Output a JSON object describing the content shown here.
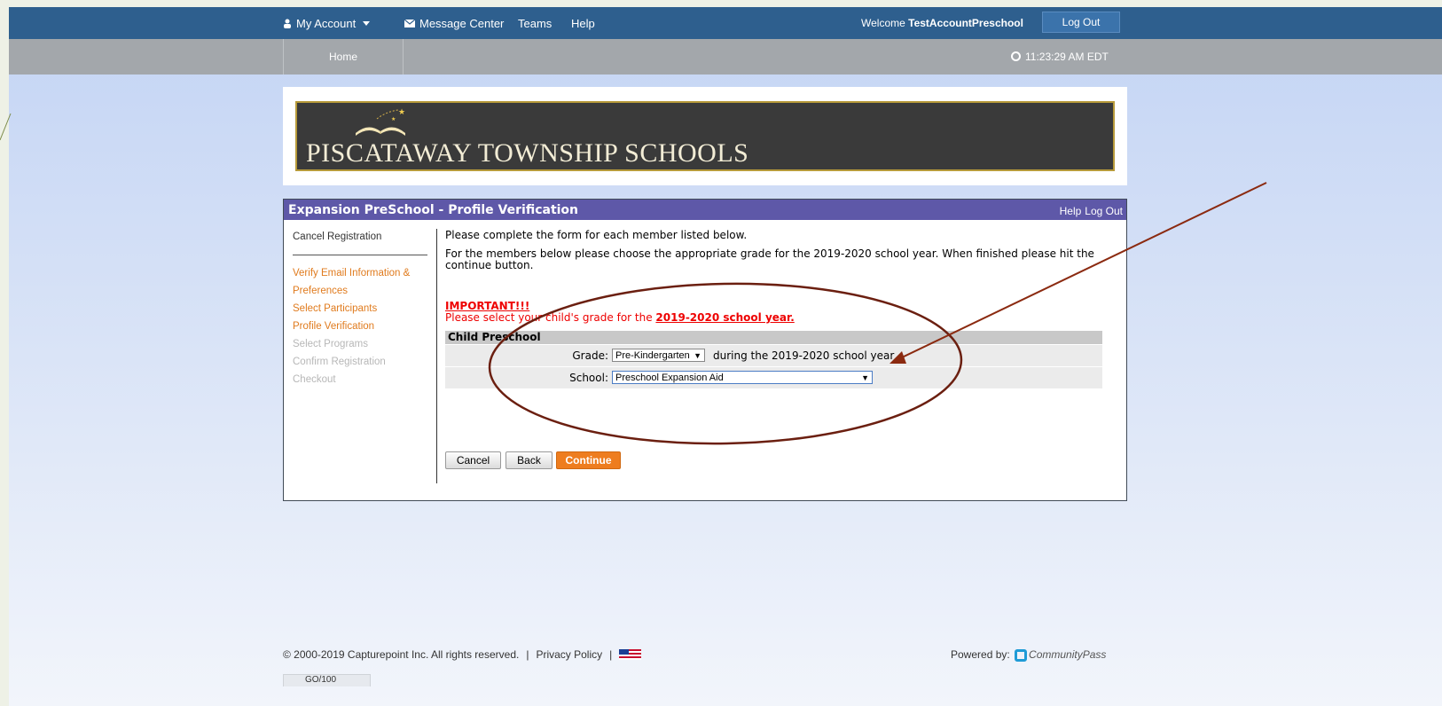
{
  "topbar": {
    "my_account": "My Account",
    "message_center": "Message Center",
    "teams": "Teams",
    "help": "Help",
    "welcome_prefix": "Welcome ",
    "username": "TestAccountPreschool",
    "logout": "Log Out"
  },
  "subbar": {
    "home": "Home",
    "time": "11:23:29 AM EDT"
  },
  "banner": {
    "title": "PISCATAWAY TOWNSHIP SCHOOLS"
  },
  "panel": {
    "title": "Expansion PreSchool - Profile Verification",
    "help": "Help",
    "logout": "Log Out"
  },
  "sidenav": {
    "cancel": "Cancel Registration",
    "steps": [
      {
        "label": "Verify Email Information & Preferences",
        "state": "done"
      },
      {
        "label": "Select Participants",
        "state": "done"
      },
      {
        "label": "Profile Verification",
        "state": "current"
      },
      {
        "label": "Select Programs",
        "state": "todo"
      },
      {
        "label": "Confirm Registration",
        "state": "todo"
      },
      {
        "label": "Checkout",
        "state": "todo"
      }
    ]
  },
  "content": {
    "intro": "Please complete the form for each member listed below.",
    "instructions": "For the members below please choose the appropriate grade for the 2019-2020 school year. When finished please hit the continue button.",
    "important": "IMPORTANT!!!",
    "select_prefix": "Please select your child's grade for the ",
    "select_year": "2019-2020 school year.",
    "member_name": "Child Preschool",
    "grade_label": "Grade:",
    "grade_value": "Pre-Kindergarten",
    "grade_suffix": "during the 2019-2020 school year",
    "school_label": "School:",
    "school_value": "Preschool Expansion Aid"
  },
  "buttons": {
    "cancel": "Cancel",
    "back": "Back",
    "continue": "Continue"
  },
  "footer": {
    "copyright": "© 2000-2019 Capturepoint Inc. All rights reserved.",
    "privacy": "Privacy Policy",
    "powered_by": "Powered by:",
    "brand": "CommunityPass",
    "badge": "GO/100"
  },
  "colors": {
    "topbar": "#2e5f8e",
    "panel_header": "#5e58a8",
    "accent_orange": "#ee7d1f",
    "annotation": "#8b2a10"
  }
}
